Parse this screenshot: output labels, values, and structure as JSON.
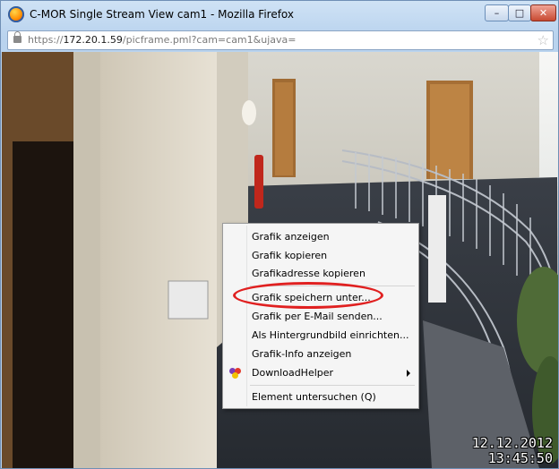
{
  "window": {
    "title": "C-MOR Single Stream View cam1 - Mozilla Firefox",
    "buttons": {
      "minimize": "–",
      "maximize": "□",
      "close": "✕"
    }
  },
  "address_bar": {
    "scheme": "https://",
    "host": "172.20.1.59",
    "path": "/picframe.pml?cam=cam1&ujava="
  },
  "camera": {
    "date": "12.12.2012",
    "time": "13:45:50"
  },
  "context_menu": {
    "items": [
      {
        "label": "Grafik anzeigen"
      },
      {
        "label": "Grafik kopieren"
      },
      {
        "label": "Grafikadresse kopieren"
      },
      {
        "label": "Grafik speichern unter..."
      },
      {
        "label": "Grafik per E-Mail senden..."
      },
      {
        "label": "Als Hintergrundbild einrichten..."
      },
      {
        "label": "Grafik-Info anzeigen"
      },
      {
        "label": "DownloadHelper",
        "icon": "downloadhelper-icon",
        "submenu": true
      },
      {
        "label": "Element untersuchen (Q)"
      }
    ]
  },
  "colors": {
    "highlight": "#e02020",
    "window_frame": "#b9d3ee"
  }
}
